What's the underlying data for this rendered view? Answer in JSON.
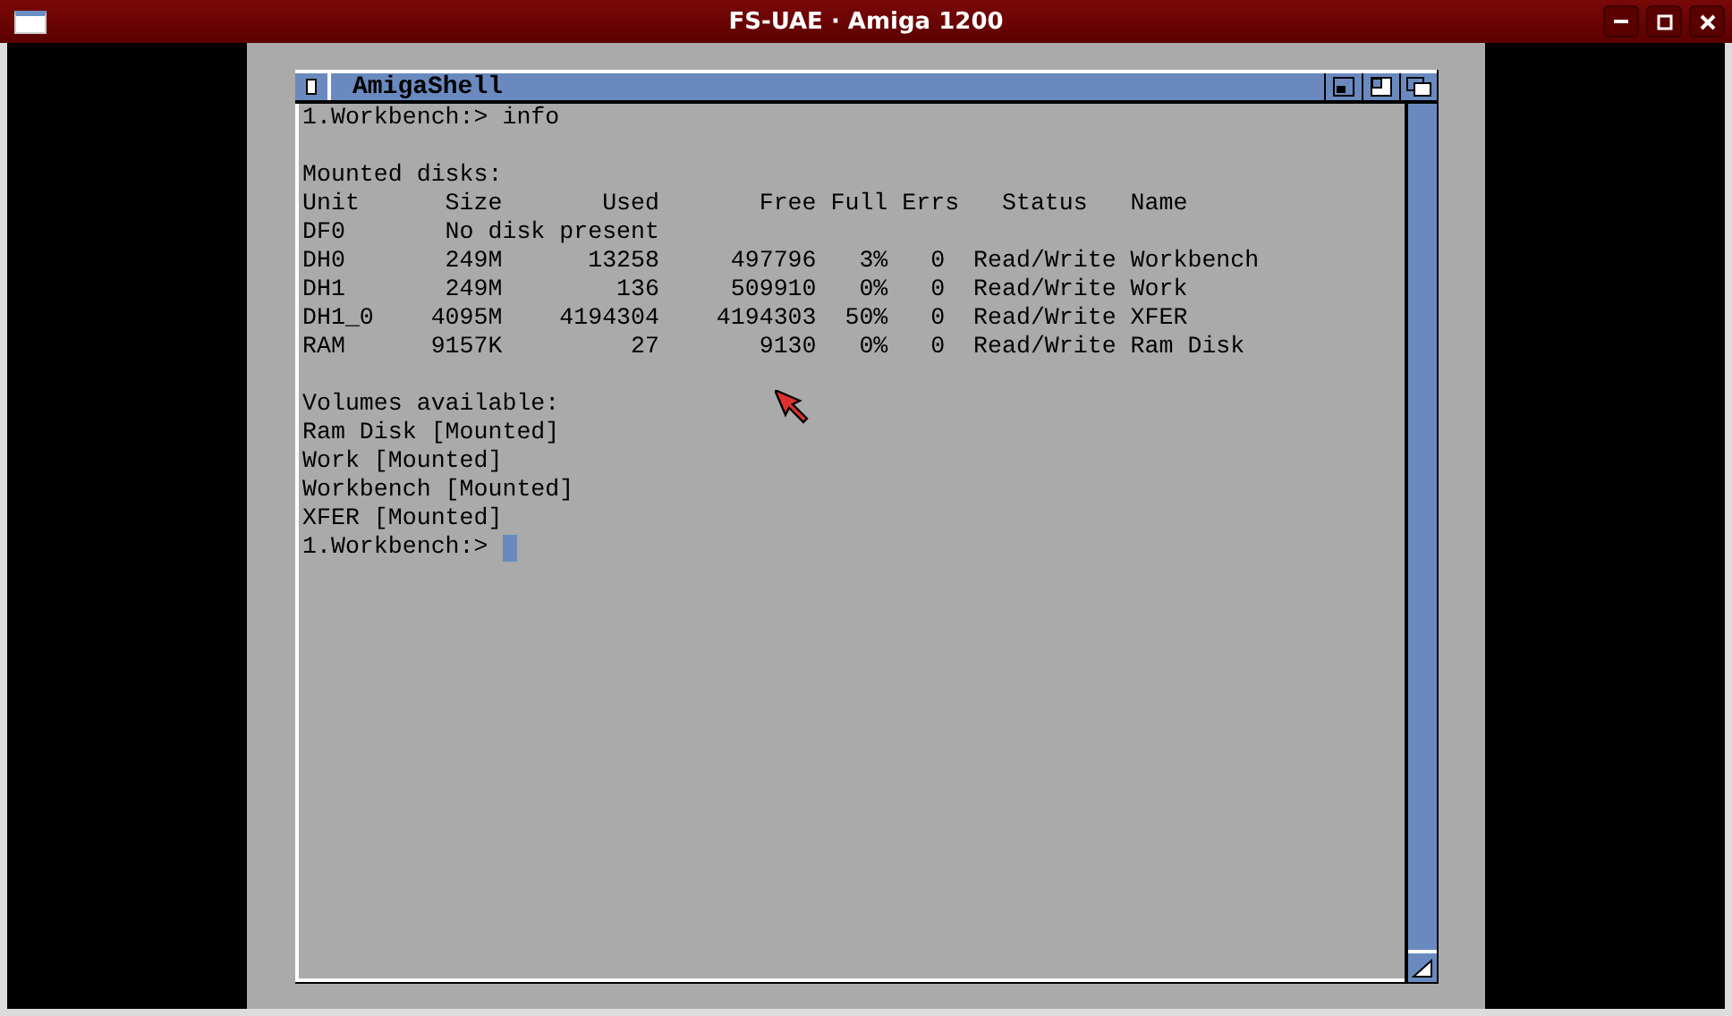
{
  "window": {
    "title": "FS-UAE · Amiga 1200"
  },
  "shell": {
    "title": "AmigaShell",
    "blocks": [
      {
        "lines": [
          "1.Workbench:> info"
        ]
      },
      {
        "lines": [
          "Mounted disks:",
          "Unit      Size       Used       Free Full Errs   Status   Name",
          "DF0       No disk present",
          "DH0       249M      13258     497796   3%   0  Read/Write Workbench",
          "DH1       249M        136     509910   0%   0  Read/Write Work",
          "DH1_0    4095M    4194304    4194303  50%   0  Read/Write XFER",
          "RAM      9157K         27       9130   0%   0  Read/Write Ram Disk"
        ]
      },
      {
        "lines": [
          "Volumes available:",
          "Ram Disk [Mounted]",
          "Work [Mounted]",
          "Workbench [Mounted]",
          "XFER [Mounted]"
        ]
      }
    ],
    "prompt": "1.Workbench:>"
  }
}
